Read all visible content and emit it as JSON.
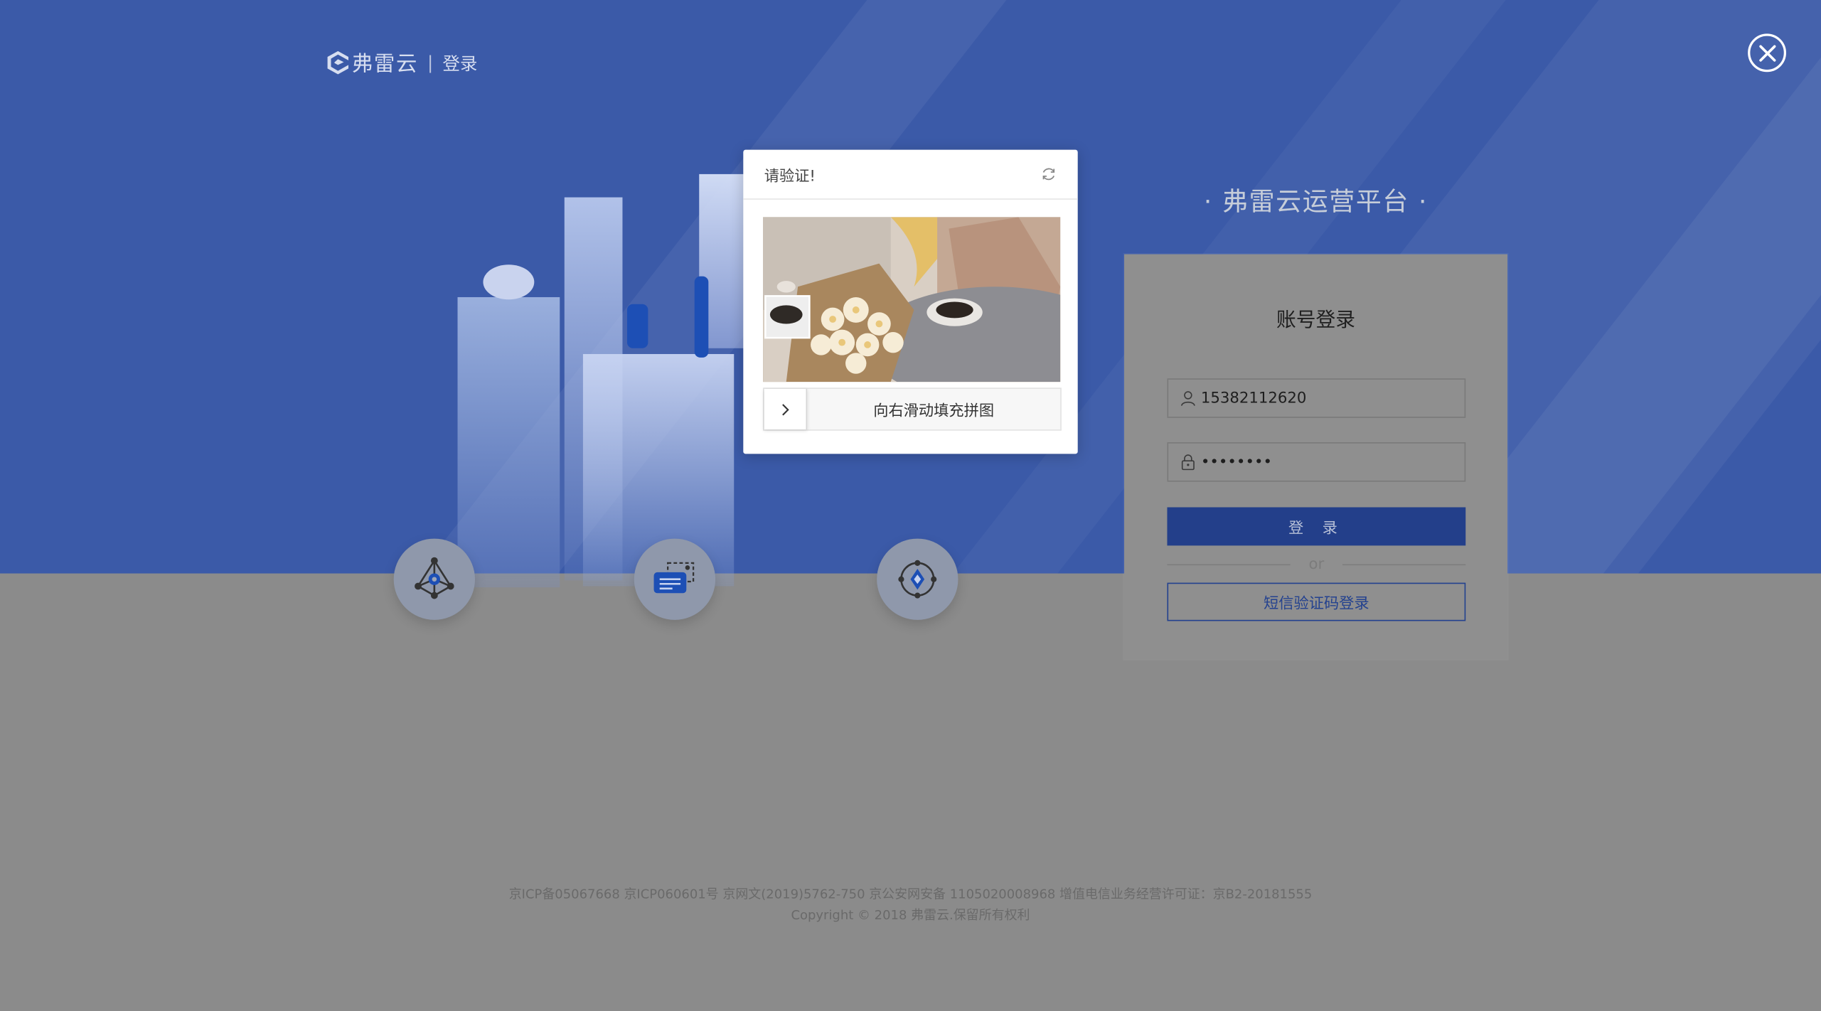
{
  "header": {
    "brand": "弗雷云",
    "separator": "|",
    "page": "登录"
  },
  "platform_title": "· 弗雷云运营平台 ·",
  "login": {
    "title": "账号登录",
    "username_value": "15382112620",
    "password_value": "••••••••",
    "submit_label": "登 录",
    "or_label": "or",
    "sms_label": "短信验证码登录"
  },
  "captcha": {
    "title": "请验证!",
    "slider_hint": "向右滑动填充拼图"
  },
  "footer": {
    "line1": "京ICP备05067668 京ICP060601号 京网文(2019)5762-750 京公安网安备 1105020008968 增值电信业务经营许可证：京B2-20181555",
    "line2": "Copyright © 2018 弗雷云.保留所有权利"
  },
  "icons": {
    "close": "close-icon",
    "refresh": "refresh-icon",
    "user": "user-icon",
    "lock": "lock-icon",
    "slider_arrow": "chevron-right-icon",
    "features": [
      "network-icon",
      "card-icon",
      "diamond-target-icon"
    ]
  },
  "colors": {
    "band": "#3b5aa8",
    "primary_button": "#233f8a",
    "overlay_bg": "#8b8b8b"
  }
}
